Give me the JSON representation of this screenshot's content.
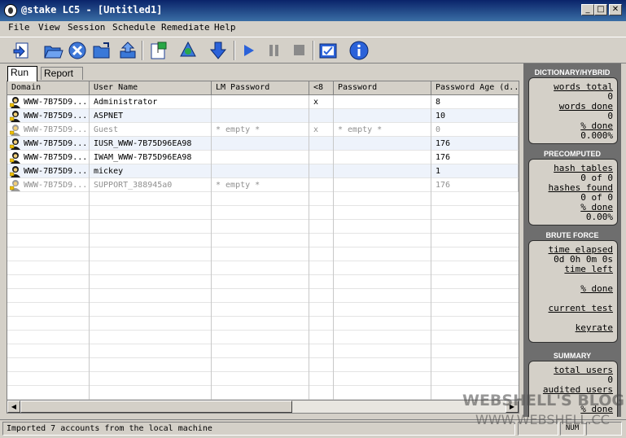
{
  "window": {
    "title": "@stake LC5 - [Untitled1]",
    "controls": {
      "minimize": "_",
      "maximize": "□",
      "close": "✕"
    }
  },
  "menu": [
    "File",
    "View",
    "Session",
    "Schedule",
    "Remediate",
    "Help"
  ],
  "toolbar": [
    "new-session-icon",
    "open-icon",
    "close-session-icon",
    "open-folder-icon",
    "import-icon",
    "session-options-icon",
    "recycle-icon",
    "download-icon",
    "play-icon",
    "pause-icon",
    "stop-icon",
    "report-icon",
    "info-icon"
  ],
  "tabs": [
    "Run",
    "Report"
  ],
  "table": {
    "columns": [
      "Domain",
      "User Name",
      "LM Password",
      "<8",
      "Password",
      "Password Age (d..."
    ],
    "rows": [
      {
        "domain": "WWW-7B75D9...",
        "user": "Administrator",
        "lm": "",
        "lt8": "x",
        "password": "",
        "age": "8",
        "disabled": false
      },
      {
        "domain": "WWW-7B75D9...",
        "user": "ASPNET",
        "lm": "",
        "lt8": "",
        "password": "",
        "age": "10",
        "disabled": false
      },
      {
        "domain": "WWW-7B75D9...",
        "user": "Guest",
        "lm": "* empty *",
        "lt8": "x",
        "password": "* empty *",
        "age": "0",
        "disabled": true
      },
      {
        "domain": "WWW-7B75D9...",
        "user": "IUSR_WWW-7B75D96EA98",
        "lm": "",
        "lt8": "",
        "password": "",
        "age": "176",
        "disabled": false
      },
      {
        "domain": "WWW-7B75D9...",
        "user": "IWAM_WWW-7B75D96EA98",
        "lm": "",
        "lt8": "",
        "password": "",
        "age": "176",
        "disabled": false
      },
      {
        "domain": "WWW-7B75D9...",
        "user": "mickey",
        "lm": "",
        "lt8": "",
        "password": "",
        "age": "1",
        "disabled": false
      },
      {
        "domain": "WWW-7B75D9...",
        "user": "SUPPORT_388945a0",
        "lm": "* empty *",
        "lt8": "",
        "password": "",
        "age": "176",
        "disabled": true
      }
    ]
  },
  "panel": {
    "dictionary": {
      "title": "DICTIONARY/HYBRID",
      "words_total_label": "words total",
      "words_total": "0",
      "words_done_label": "words done",
      "words_done": "0",
      "pct_done_label": "% done",
      "pct_done": "0.000%"
    },
    "precomputed": {
      "title": "PRECOMPUTED",
      "hash_tables_label": "hash tables",
      "hash_tables": "0 of 0",
      "hashes_found_label": "hashes found",
      "hashes_found": "0 of 0",
      "pct_done_label": "% done",
      "pct_done": "0.00%"
    },
    "brute": {
      "title": "BRUTE FORCE",
      "time_elapsed_label": "time elapsed",
      "time_elapsed": "0d 0h 0m 0s",
      "time_left_label": "time left",
      "pct_done_label": "% done",
      "current_test_label": "current test",
      "keyrate_label": "keyrate"
    },
    "summary": {
      "title": "SUMMARY",
      "total_users_label": "total users",
      "total_users": "0",
      "audited_users_label": "audited users",
      "pct_done_label": "% done"
    }
  },
  "status": {
    "message": "Imported 7 accounts from the local machine",
    "num": "NUM"
  },
  "watermark": {
    "line1": "WEBSHELL'S BLOG",
    "line2": "WWW.WEBSHELL.CC"
  }
}
